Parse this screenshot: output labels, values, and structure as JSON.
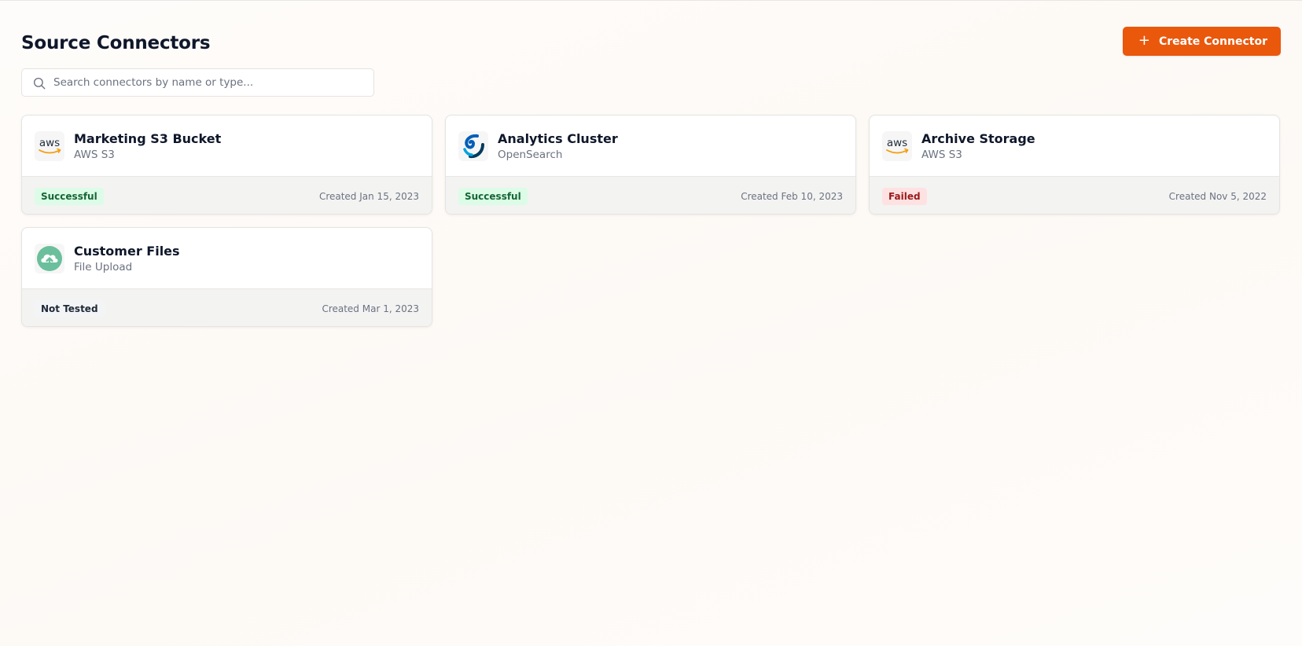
{
  "header": {
    "title": "Source Connectors",
    "create_label": "Create Connector",
    "create_icon": "+"
  },
  "search": {
    "placeholder": "Search connectors by name or type...",
    "value": ""
  },
  "connectors": [
    {
      "name": "Marketing S3 Bucket",
      "type": "AWS S3",
      "status": "Successful",
      "status_kind": "success",
      "created": "Created Jan 15, 2023",
      "logo": "aws-logo-icon"
    },
    {
      "name": "Analytics Cluster",
      "type": "OpenSearch",
      "status": "Successful",
      "status_kind": "success",
      "created": "Created Feb 10, 2023",
      "logo": "opensearch-logo-icon"
    },
    {
      "name": "Archive Storage",
      "type": "AWS S3",
      "status": "Failed",
      "status_kind": "failed",
      "created": "Created Nov 5, 2022",
      "logo": "aws-logo-icon"
    },
    {
      "name": "Customer Files",
      "type": "File Upload",
      "status": "Not Tested",
      "status_kind": "untested",
      "created": "Created Mar 1, 2023",
      "logo": "cloud-upload-icon"
    }
  ],
  "logos": {
    "aws_text": "aws"
  },
  "colors": {
    "accent": "#ea580c",
    "success_bg": "#dcfce7",
    "success_fg": "#166534",
    "failed_bg": "#fee2e2",
    "failed_fg": "#991b1b"
  }
}
